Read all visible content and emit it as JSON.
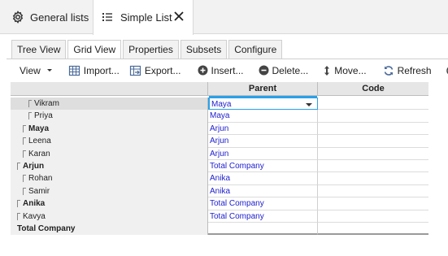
{
  "doc_tabs": [
    {
      "label": "General lists",
      "icon": "gear-icon",
      "active": false
    },
    {
      "label": "Simple List",
      "icon": "list-icon",
      "active": true
    }
  ],
  "view_tabs": [
    {
      "label": "Tree View",
      "active": false
    },
    {
      "label": "Grid View",
      "active": true
    },
    {
      "label": "Properties",
      "active": false
    },
    {
      "label": "Subsets",
      "active": false
    },
    {
      "label": "Configure",
      "active": false
    }
  ],
  "toolbar": {
    "view": "View",
    "import": "Import...",
    "export": "Export...",
    "insert": "Insert...",
    "delete": "Delete...",
    "move": "Move...",
    "refresh": "Refresh"
  },
  "grid": {
    "columns": [
      "Parent",
      "Code"
    ],
    "rows": [
      {
        "label": "Vikram",
        "bold": false,
        "depth": 3,
        "parent": "Maya",
        "code": "",
        "selected": true
      },
      {
        "label": "Priya",
        "bold": false,
        "depth": 3,
        "parent": "Maya",
        "code": ""
      },
      {
        "label": "Maya",
        "bold": true,
        "depth": 2,
        "parent": "Arjun",
        "code": ""
      },
      {
        "label": "Leena",
        "bold": false,
        "depth": 2,
        "parent": "Arjun",
        "code": ""
      },
      {
        "label": "Karan",
        "bold": false,
        "depth": 2,
        "parent": "Arjun",
        "code": ""
      },
      {
        "label": "Arjun",
        "bold": true,
        "depth": 1,
        "parent": "Total Company",
        "code": ""
      },
      {
        "label": "Rohan",
        "bold": false,
        "depth": 2,
        "parent": "Anika",
        "code": ""
      },
      {
        "label": "Samir",
        "bold": false,
        "depth": 2,
        "parent": "Anika",
        "code": ""
      },
      {
        "label": "Anika",
        "bold": true,
        "depth": 1,
        "parent": "Total Company",
        "code": ""
      },
      {
        "label": "Kavya",
        "bold": false,
        "depth": 1,
        "parent": "Total Company",
        "code": ""
      },
      {
        "label": "Total Company",
        "bold": true,
        "depth": 0,
        "parent": "",
        "code": ""
      }
    ]
  },
  "colors": {
    "accent": "#2aa0e8",
    "link": "#2020d0",
    "header_bg": "#e6e6e6"
  }
}
